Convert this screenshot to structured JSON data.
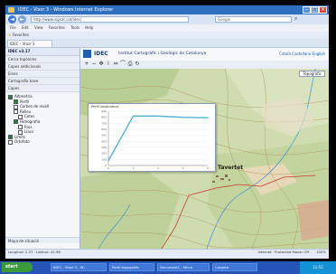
{
  "window": {
    "title": "IDEC - Visor 3 - Windows Internet Explorer"
  },
  "browser": {
    "address": "http://www.sigcat.cat/idec/",
    "search_placeholder": "Google",
    "menu": [
      "File",
      "Edit",
      "View",
      "Favorites",
      "Tools",
      "Help"
    ],
    "favorites_label": "Favorites",
    "tab_label": "IDEC - Visor 3",
    "commands": "Page ▾  Safety ▾  Tools ▾"
  },
  "sidebar": {
    "header": "IDEC v3.17",
    "sections": [
      "Cerca topònims",
      "Capes addicionals",
      "Eines",
      "Cartografia base",
      "Capes"
    ],
    "tree": [
      {
        "label": "Altimetria",
        "level": 1,
        "checked": true
      },
      {
        "label": "Perfil",
        "level": 2,
        "checked": true
      },
      {
        "label": "Corbes de nivell",
        "level": 2,
        "checked": false
      },
      {
        "label": "Relleu",
        "level": 2,
        "checked": false
      },
      {
        "label": "Cotes",
        "level": 3,
        "checked": false
      },
      {
        "label": "Hidrografia",
        "level": 2,
        "checked": true
      },
      {
        "label": "Rius",
        "level": 3,
        "checked": false
      },
      {
        "label": "Llacs",
        "level": 3,
        "checked": false
      },
      {
        "label": "Límits",
        "level": 1,
        "checked": true
      },
      {
        "label": "Ortofoto",
        "level": 1,
        "checked": false
      }
    ],
    "bottom": "Mapa de situació"
  },
  "app": {
    "logo_text": "IDEC",
    "subtitle": "Institut Cartogràfic i Geològic de Catalunya",
    "links": "Català  Castellano  English"
  },
  "map": {
    "place_label": "Tavertet",
    "button_label": "Topogràfic"
  },
  "chart_data": {
    "type": "line",
    "title": "Perfil longitudinal",
    "x": [
      0,
      1,
      2,
      3,
      4
    ],
    "values": [
      80,
      820,
      820,
      800,
      790
    ],
    "ylim": [
      0,
      900
    ],
    "series_color": "#4fb1d6"
  },
  "status": {
    "left": "Longitud: 2.37 · Latitud: 41.98",
    "right": "Internet · Protected Mode: Off",
    "zoom": "100%"
  },
  "taskbar": {
    "start_label": "start",
    "tasks": [
      "IDEC - Visor 3 - W...",
      "Perfil topogràfic",
      "Document1 - Micro",
      "Carpeta"
    ],
    "clock": "11:52"
  }
}
